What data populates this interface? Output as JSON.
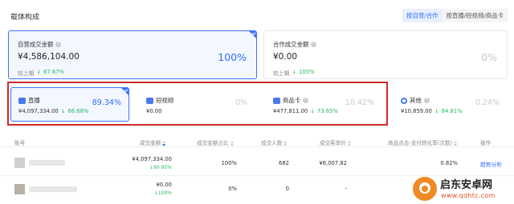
{
  "section_title": "载体构成",
  "view_toggle": {
    "options": [
      "按自营/合作",
      "按直播/短视频/商品卡"
    ],
    "selected": "按自营/合作"
  },
  "summary_cards": [
    {
      "label": "自营成交金额",
      "value": "¥4,586,104.00",
      "compare_label": "较上期",
      "compare_value": "67.67%",
      "share": "100%",
      "selected": true
    },
    {
      "label": "合作成交金额",
      "value": "¥0.00",
      "compare_label": "较上期",
      "compare_value": "100%",
      "share": "0%",
      "selected": false
    }
  ],
  "channel_cards": [
    {
      "label": "直播",
      "icon": "live-tv-icon",
      "value": "¥4,097,334.00",
      "change": "66.68%",
      "share": "89.34%",
      "selected": true
    },
    {
      "label": "短视频",
      "icon": "video-play-icon",
      "value": "¥0.00",
      "change": "",
      "share": "0%",
      "selected": false
    },
    {
      "label": "商品卡",
      "icon": "product-card-icon",
      "value": "¥477,811.00",
      "change": "73.65%",
      "share": "10.42%",
      "selected": false
    },
    {
      "label": "其他",
      "icon": "circle-icon",
      "value": "¥10,859.00",
      "change": "84.81%",
      "share": "0.24%",
      "selected": false
    }
  ],
  "table": {
    "headers": {
      "account": "账号",
      "amount": "成交金额",
      "amount_share": "成交金额占比",
      "buyers": "成交人数",
      "price": "成交客单价",
      "conversion": "商品点击-支付转化率(次数)",
      "actions": "操作"
    },
    "rows": [
      {
        "amount": "¥4,097,334.00",
        "amount_change": "60.95%",
        "share": "100%",
        "buyers": "682",
        "price": "¥6,007.82",
        "conversion": "0.82%",
        "action": "趋势分析"
      },
      {
        "amount": "¥0.00",
        "amount_change": "100%",
        "share": "0%",
        "buyers": "0",
        "price": "-",
        "conversion": "",
        "action": ""
      }
    ]
  },
  "watermark": {
    "title": "启东安卓网",
    "url": "www.qdhtc.com"
  },
  "colors": {
    "accent": "#2f6bff",
    "positive": "#25b864",
    "highlight_frame": "#cf2a2a",
    "watermark_logo": "#f08a24"
  }
}
